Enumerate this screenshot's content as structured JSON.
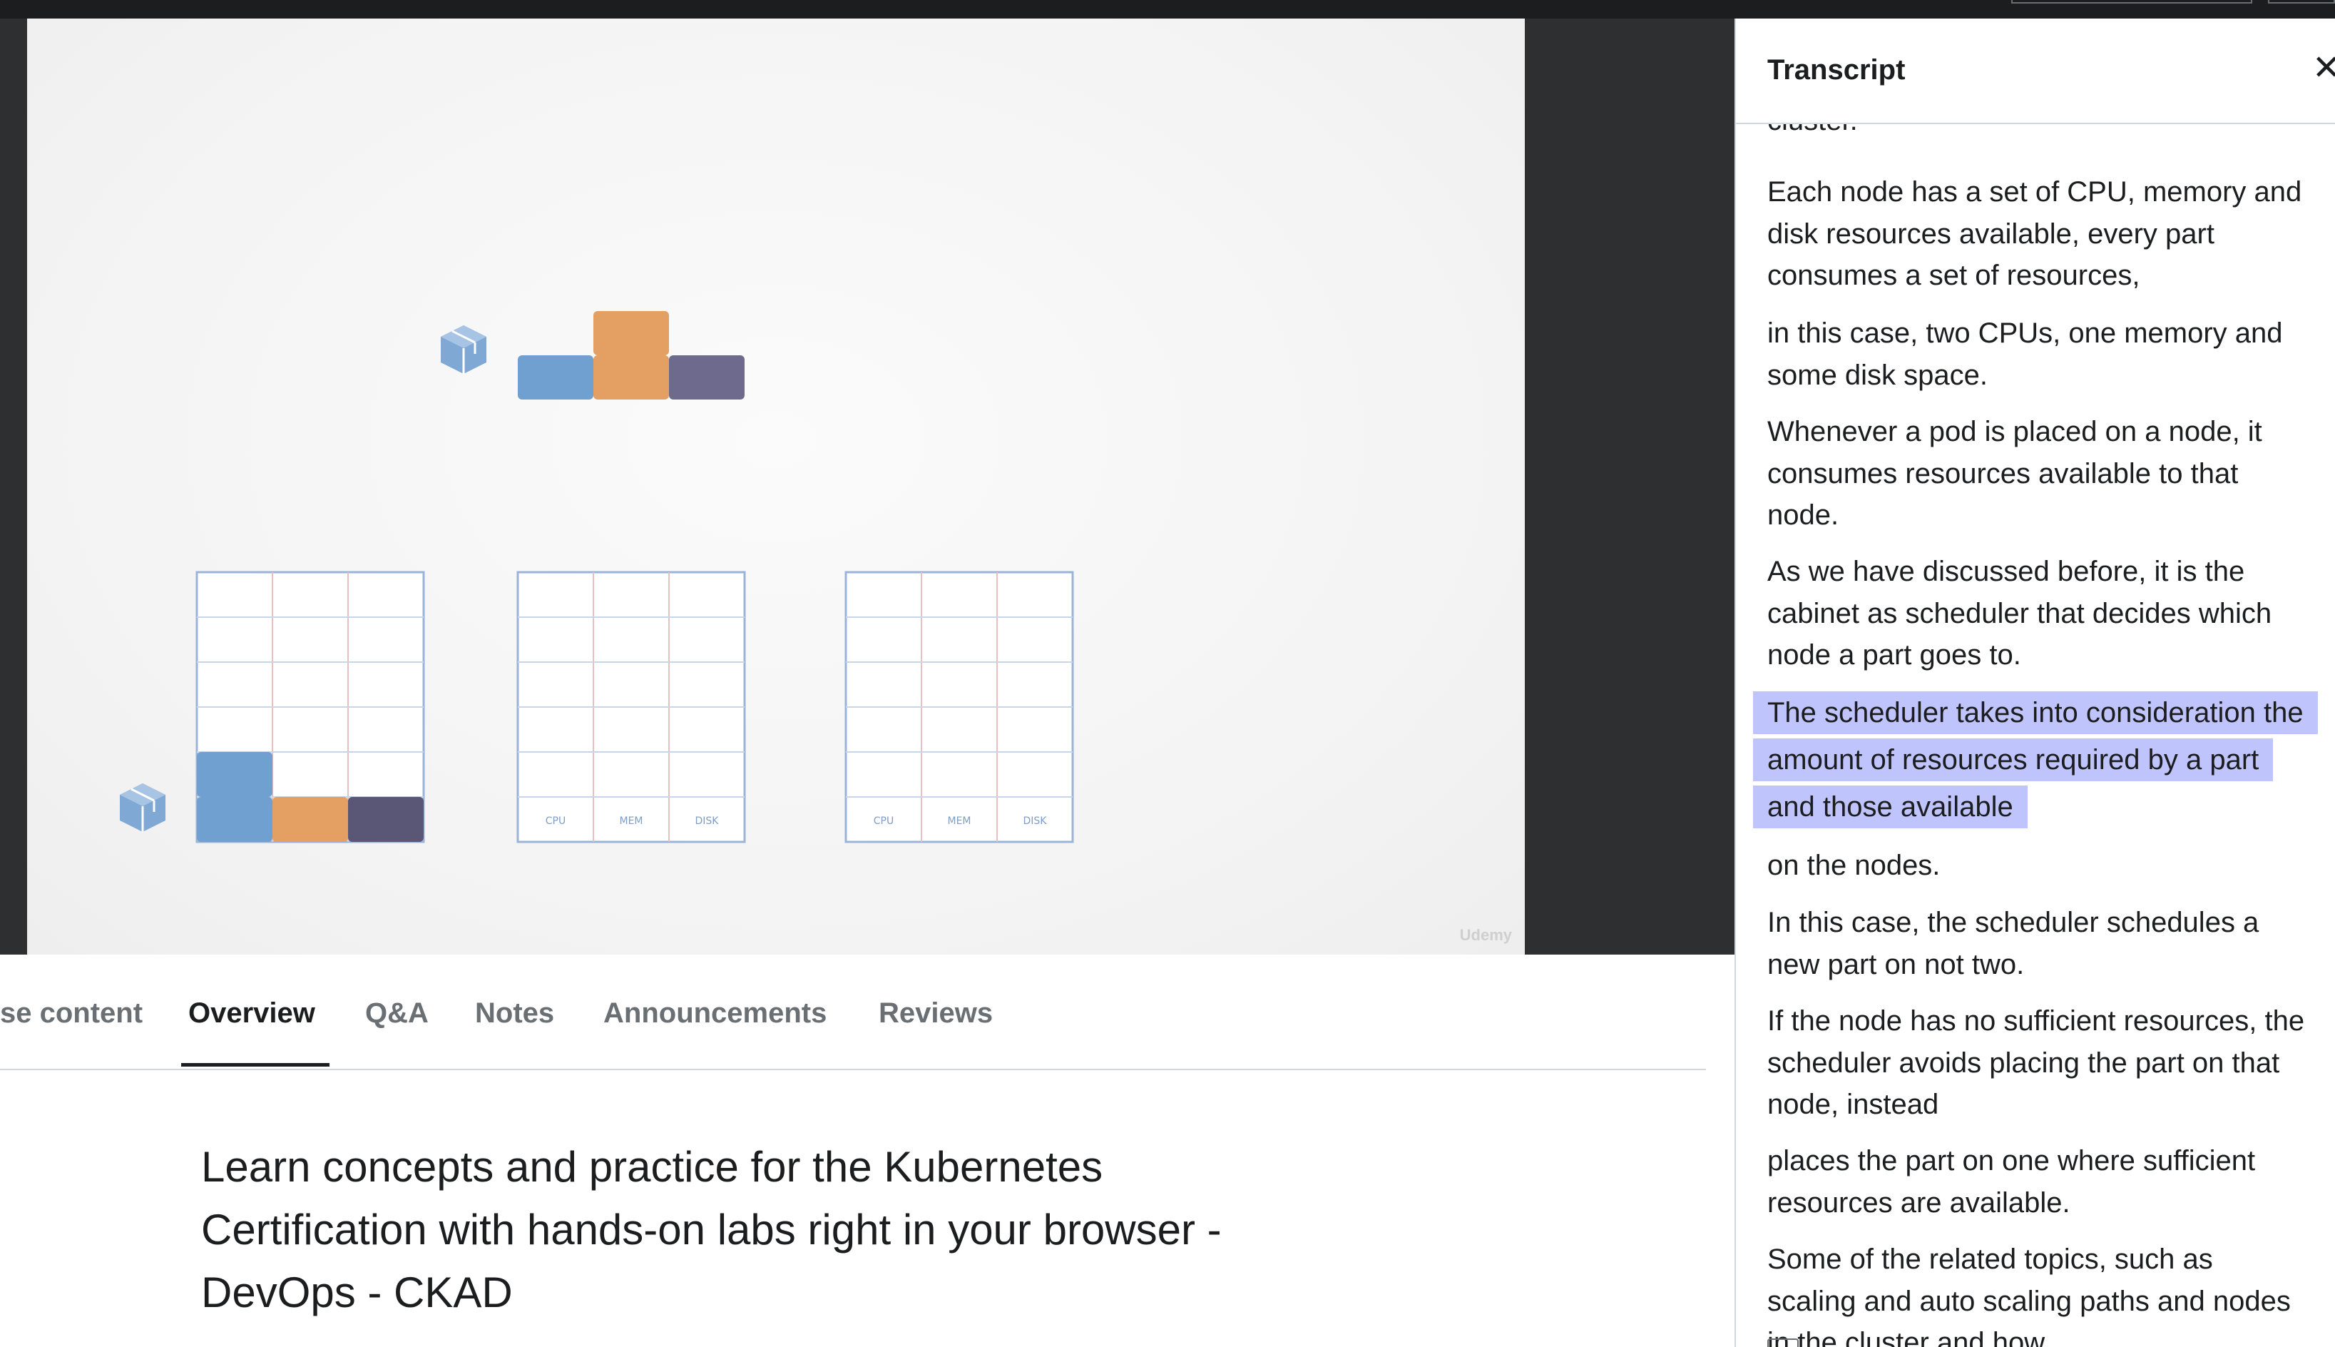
{
  "transcript": {
    "title": "Transcript",
    "partial_top": "cluster.",
    "cues": [
      "Each node has a set of CPU, memory and disk resources available, every part consumes a set of resources,",
      "in this case, two CPUs, one memory and some disk space.",
      "Whenever a pod is placed on a node, it consumes resources available to that node.",
      "As we have discussed before, it is the cabinet as scheduler that decides which node a part goes to.",
      "The scheduler takes into consideration the amount of resources required by a part and those available",
      "on the nodes.",
      "In this case, the scheduler schedules a new part on not two.",
      "If the node has no sufficient resources, the scheduler avoids placing the part on that node, instead",
      "places the part on one where sufficient resources are available.",
      "Some of the related topics, such as scaling and auto scaling paths and nodes in the cluster and how"
    ],
    "active_index": 4
  },
  "tabs": {
    "items": [
      "se content",
      "Overview",
      "Q&A",
      "Notes",
      "Announcements",
      "Reviews"
    ],
    "active": "Overview"
  },
  "overview": {
    "title": "Learn concepts and practice for the Kubernetes Certification with hands-on labs right in your browser - DevOps - CKAD"
  },
  "video": {
    "grid_labels": [
      "CPU",
      "MEM",
      "DISK"
    ],
    "watermark": "Udemy",
    "colors": {
      "cpu": "#6fa0cf",
      "mem": "#e3a062",
      "disk": "#6e6a8e",
      "disk_dark": "#5a5675"
    }
  }
}
